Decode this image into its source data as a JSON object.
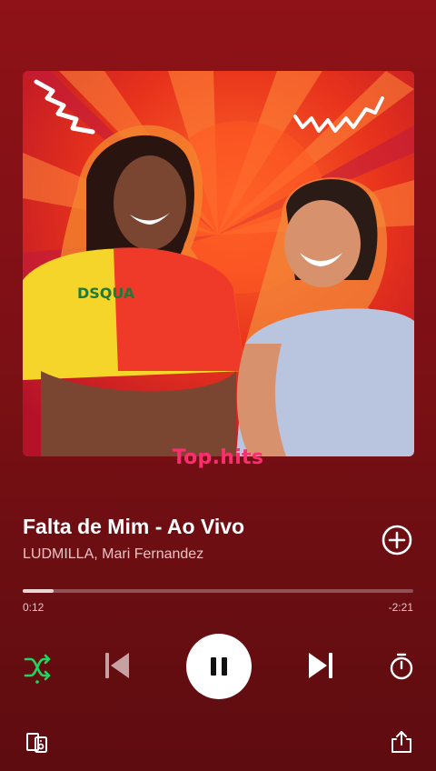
{
  "watermark": "Top.hits",
  "track": {
    "title": "Falta de Mim - Ao Vivo",
    "artists": "LUDMILLA, Mari Fernandez"
  },
  "playback": {
    "elapsed": "0:12",
    "remaining": "-2:21",
    "progress_fraction": 0.08,
    "state": "playing"
  },
  "icons": {
    "add": "plus-circle-icon",
    "shuffle": "shuffle-icon",
    "previous": "skip-previous-icon",
    "pause": "pause-icon",
    "next": "skip-next-icon",
    "sleep_timer": "timer-icon",
    "devices": "devices-icon",
    "share": "share-icon"
  },
  "colors": {
    "background": "#7d1015",
    "shuffle_active": "#1ed760",
    "watermark": "#ff2d6f"
  }
}
